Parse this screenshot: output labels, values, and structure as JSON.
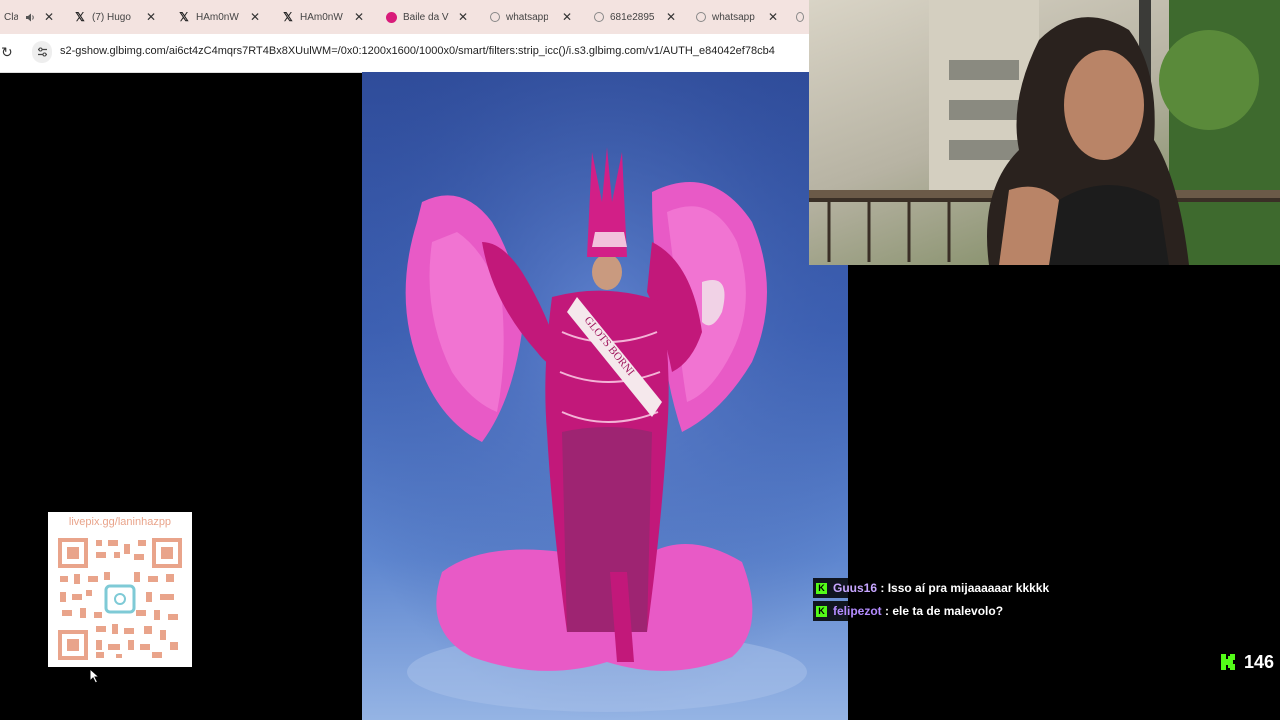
{
  "browser": {
    "tabs": [
      {
        "title": "Cla",
        "icon": "speaker-icon"
      },
      {
        "title": "(7) Hugo",
        "icon": "x-logo-icon"
      },
      {
        "title": "HAm0nW",
        "icon": "x-logo-icon"
      },
      {
        "title": "HAm0nW",
        "icon": "x-logo-icon"
      },
      {
        "title": "Baile da V",
        "icon": "pink-circle-icon"
      },
      {
        "title": "whatsapp",
        "icon": "globe-icon"
      },
      {
        "title": "681e2895",
        "icon": "globe-icon"
      },
      {
        "title": "whatsapp",
        "icon": "globe-icon"
      }
    ],
    "url": "s2-gshow.glbimg.com/ai6ct4zC4mqrs7RT4Bx8XUulWM=/0x0:1200x1600/1000x0/smart/filters:strip_icc()/i.s3.glbimg.com/v1/AUTH_e84042ef78cb4"
  },
  "photo": {
    "sash_text": "GLOTS BORNI",
    "colors": {
      "background": "#3d61b4",
      "feathers": "#e74fc1",
      "costume": "#c2187a"
    }
  },
  "qr": {
    "label": "livepix.gg/laninhazpp",
    "color": "#e9a48b"
  },
  "chat": {
    "messages": [
      {
        "user": "Guus16",
        "separator": " : ",
        "text": "Isso aí pra mijaaaaaar kkkkk"
      },
      {
        "user": "felipezot",
        "separator": " : ",
        "text": "ele ta de malevolo?"
      }
    ],
    "badge_letter": "K",
    "accent": "#53fc18"
  },
  "stream": {
    "viewer_count": "146"
  }
}
